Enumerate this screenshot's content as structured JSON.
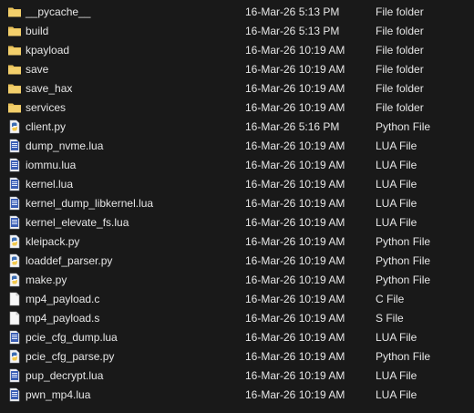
{
  "colors": {
    "background": "#191919",
    "text": "#e6e6e6",
    "folder": "#e8c15a",
    "lua_blue": "#3b5fb5",
    "python_blue": "#3b6db3",
    "python_yellow": "#f2c94c"
  },
  "files": [
    {
      "name": "__pycache__",
      "date": "16-Mar-26 5:13 PM",
      "type": "File folder",
      "icon": "folder-icon"
    },
    {
      "name": "build",
      "date": "16-Mar-26 5:13 PM",
      "type": "File folder",
      "icon": "folder-icon"
    },
    {
      "name": "kpayload",
      "date": "16-Mar-26 10:19 AM",
      "type": "File folder",
      "icon": "folder-icon"
    },
    {
      "name": "save",
      "date": "16-Mar-26 10:19 AM",
      "type": "File folder",
      "icon": "folder-icon"
    },
    {
      "name": "save_hax",
      "date": "16-Mar-26 10:19 AM",
      "type": "File folder",
      "icon": "folder-icon"
    },
    {
      "name": "services",
      "date": "16-Mar-26 10:19 AM",
      "type": "File folder",
      "icon": "folder-icon"
    },
    {
      "name": "client.py",
      "date": "16-Mar-26 5:16 PM",
      "type": "Python File",
      "icon": "python-file-icon"
    },
    {
      "name": "dump_nvme.lua",
      "date": "16-Mar-26 10:19 AM",
      "type": "LUA File",
      "icon": "lua-file-icon"
    },
    {
      "name": "iommu.lua",
      "date": "16-Mar-26 10:19 AM",
      "type": "LUA File",
      "icon": "lua-file-icon"
    },
    {
      "name": "kernel.lua",
      "date": "16-Mar-26 10:19 AM",
      "type": "LUA File",
      "icon": "lua-file-icon"
    },
    {
      "name": "kernel_dump_libkernel.lua",
      "date": "16-Mar-26 10:19 AM",
      "type": "LUA File",
      "icon": "lua-file-icon"
    },
    {
      "name": "kernel_elevate_fs.lua",
      "date": "16-Mar-26 10:19 AM",
      "type": "LUA File",
      "icon": "lua-file-icon"
    },
    {
      "name": "kleipack.py",
      "date": "16-Mar-26 10:19 AM",
      "type": "Python File",
      "icon": "python-file-icon"
    },
    {
      "name": "loaddef_parser.py",
      "date": "16-Mar-26 10:19 AM",
      "type": "Python File",
      "icon": "python-file-icon"
    },
    {
      "name": "make.py",
      "date": "16-Mar-26 10:19 AM",
      "type": "Python File",
      "icon": "python-file-icon"
    },
    {
      "name": "mp4_payload.c",
      "date": "16-Mar-26 10:19 AM",
      "type": "C File",
      "icon": "generic-file-icon"
    },
    {
      "name": "mp4_payload.s",
      "date": "16-Mar-26 10:19 AM",
      "type": "S File",
      "icon": "generic-file-icon"
    },
    {
      "name": "pcie_cfg_dump.lua",
      "date": "16-Mar-26 10:19 AM",
      "type": "LUA File",
      "icon": "lua-file-icon"
    },
    {
      "name": "pcie_cfg_parse.py",
      "date": "16-Mar-26 10:19 AM",
      "type": "Python File",
      "icon": "python-file-icon"
    },
    {
      "name": "pup_decrypt.lua",
      "date": "16-Mar-26 10:19 AM",
      "type": "LUA File",
      "icon": "lua-file-icon"
    },
    {
      "name": "pwn_mp4.lua",
      "date": "16-Mar-26 10:19 AM",
      "type": "LUA File",
      "icon": "lua-file-icon"
    }
  ]
}
